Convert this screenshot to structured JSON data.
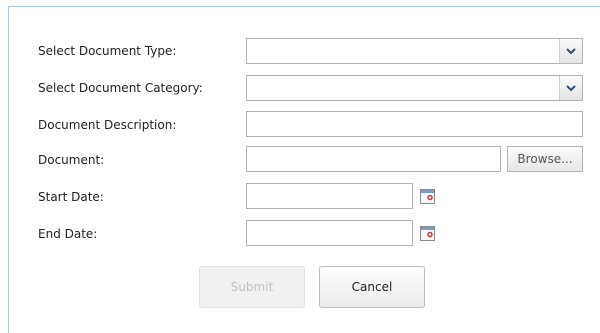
{
  "form": {
    "doc_type_label": "Select Document Type:",
    "doc_type_value": "",
    "doc_category_label": "Select Document Category:",
    "doc_category_value": "",
    "description_label": "Document Description:",
    "description_value": "",
    "document_label": "Document:",
    "document_value": "",
    "browse_label": "Browse...",
    "start_date_label": "Start Date:",
    "start_date_value": "",
    "end_date_label": "End Date:",
    "end_date_value": ""
  },
  "actions": {
    "submit_label": "Submit",
    "cancel_label": "Cancel",
    "submit_disabled": true
  },
  "icons": {
    "dropdown": "chevron-down-icon",
    "calendar": "calendar-icon"
  },
  "colors": {
    "panel_border": "#a9c6e6",
    "chevron": "#2d4d7a",
    "calendar_accent": "#d23a3a"
  }
}
